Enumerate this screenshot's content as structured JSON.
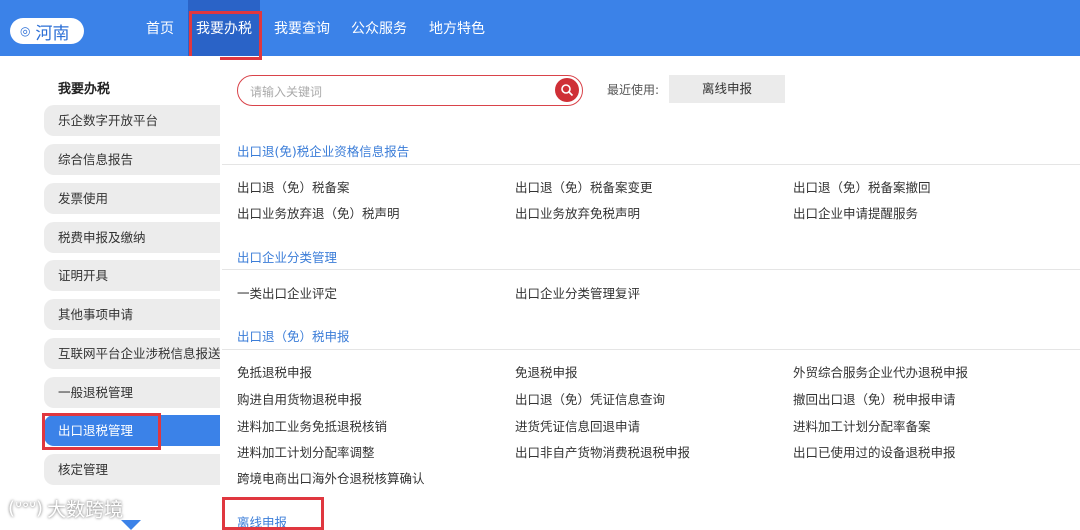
{
  "header": {
    "region": "河南",
    "nav": [
      "首页",
      "我要办税",
      "我要查询",
      "公众服务",
      "地方特色"
    ]
  },
  "sidebar": {
    "title": "我要办税",
    "items": [
      "乐企数字开放平台",
      "综合信息报告",
      "发票使用",
      "税费申报及缴纳",
      "证明开具",
      "其他事项申请",
      "互联网平台企业涉税信息报送",
      "一般退税管理",
      "出口退税管理",
      "核定管理"
    ]
  },
  "search": {
    "placeholder": "请输入关键词",
    "recent_label": "最近使用:",
    "recent_item": "离线申报"
  },
  "sections": [
    {
      "title": "出口退(免)税企业资格信息报告",
      "links": [
        "出口退（免）税备案",
        "出口退（免）税备案变更",
        "出口退（免）税备案撤回",
        "出口业务放弃退（免）税声明",
        "出口业务放弃免税声明",
        "出口企业申请提醒服务"
      ]
    },
    {
      "title": "出口企业分类管理",
      "links": [
        "一类出口企业评定",
        "出口企业分类管理复评"
      ]
    },
    {
      "title": "出口退（免）税申报",
      "links": [
        "免抵退税申报",
        "免退税申报",
        "外贸综合服务企业代办退税申报",
        "购进自用货物退税申报",
        "出口退（免）凭证信息查询",
        "撤回出口退（免）税申报申请",
        "进料加工业务免抵退税核销",
        "进货凭证信息回退申请",
        "进料加工计划分配率备案",
        "进料加工计划分配率调整",
        "出口非自产货物消费税退税申报",
        "出口已使用过的设备退税申报",
        "跨境电商出口海外仓退税核算确认"
      ]
    },
    {
      "title": "离线申报",
      "links": []
    }
  ],
  "watermark": "大数跨境",
  "colors": {
    "nav_bg": "#3b82e8",
    "active_nav": "#2a63c7",
    "highlight": "#e0373f",
    "link_blue": "#3b7dd8"
  }
}
